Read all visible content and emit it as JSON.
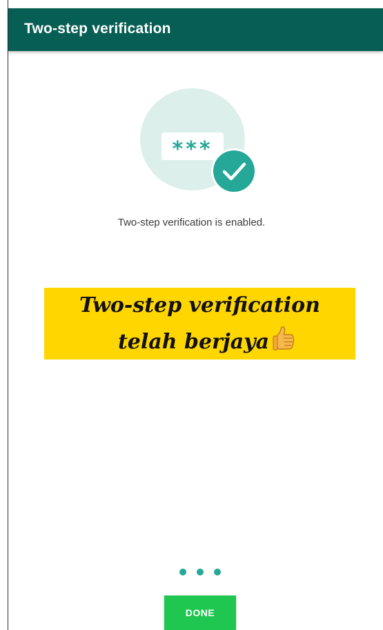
{
  "app_bar": {
    "title": "Two-step verification"
  },
  "illustration": {
    "password_mask": "***",
    "icons": [
      "password-card-icon",
      "check-badge-icon"
    ]
  },
  "status": {
    "message": "Two-step verification is enabled."
  },
  "banner": {
    "line1": "Two-step verification",
    "line2": "telah berjaya",
    "emoji": "thumbs-up-icon"
  },
  "pager": {
    "dot_count": 3
  },
  "actions": {
    "done_label": "DONE"
  },
  "colors": {
    "app_bar": "#075e54",
    "accent": "#25a897",
    "button": "#1fc650",
    "banner": "#ffd600"
  }
}
